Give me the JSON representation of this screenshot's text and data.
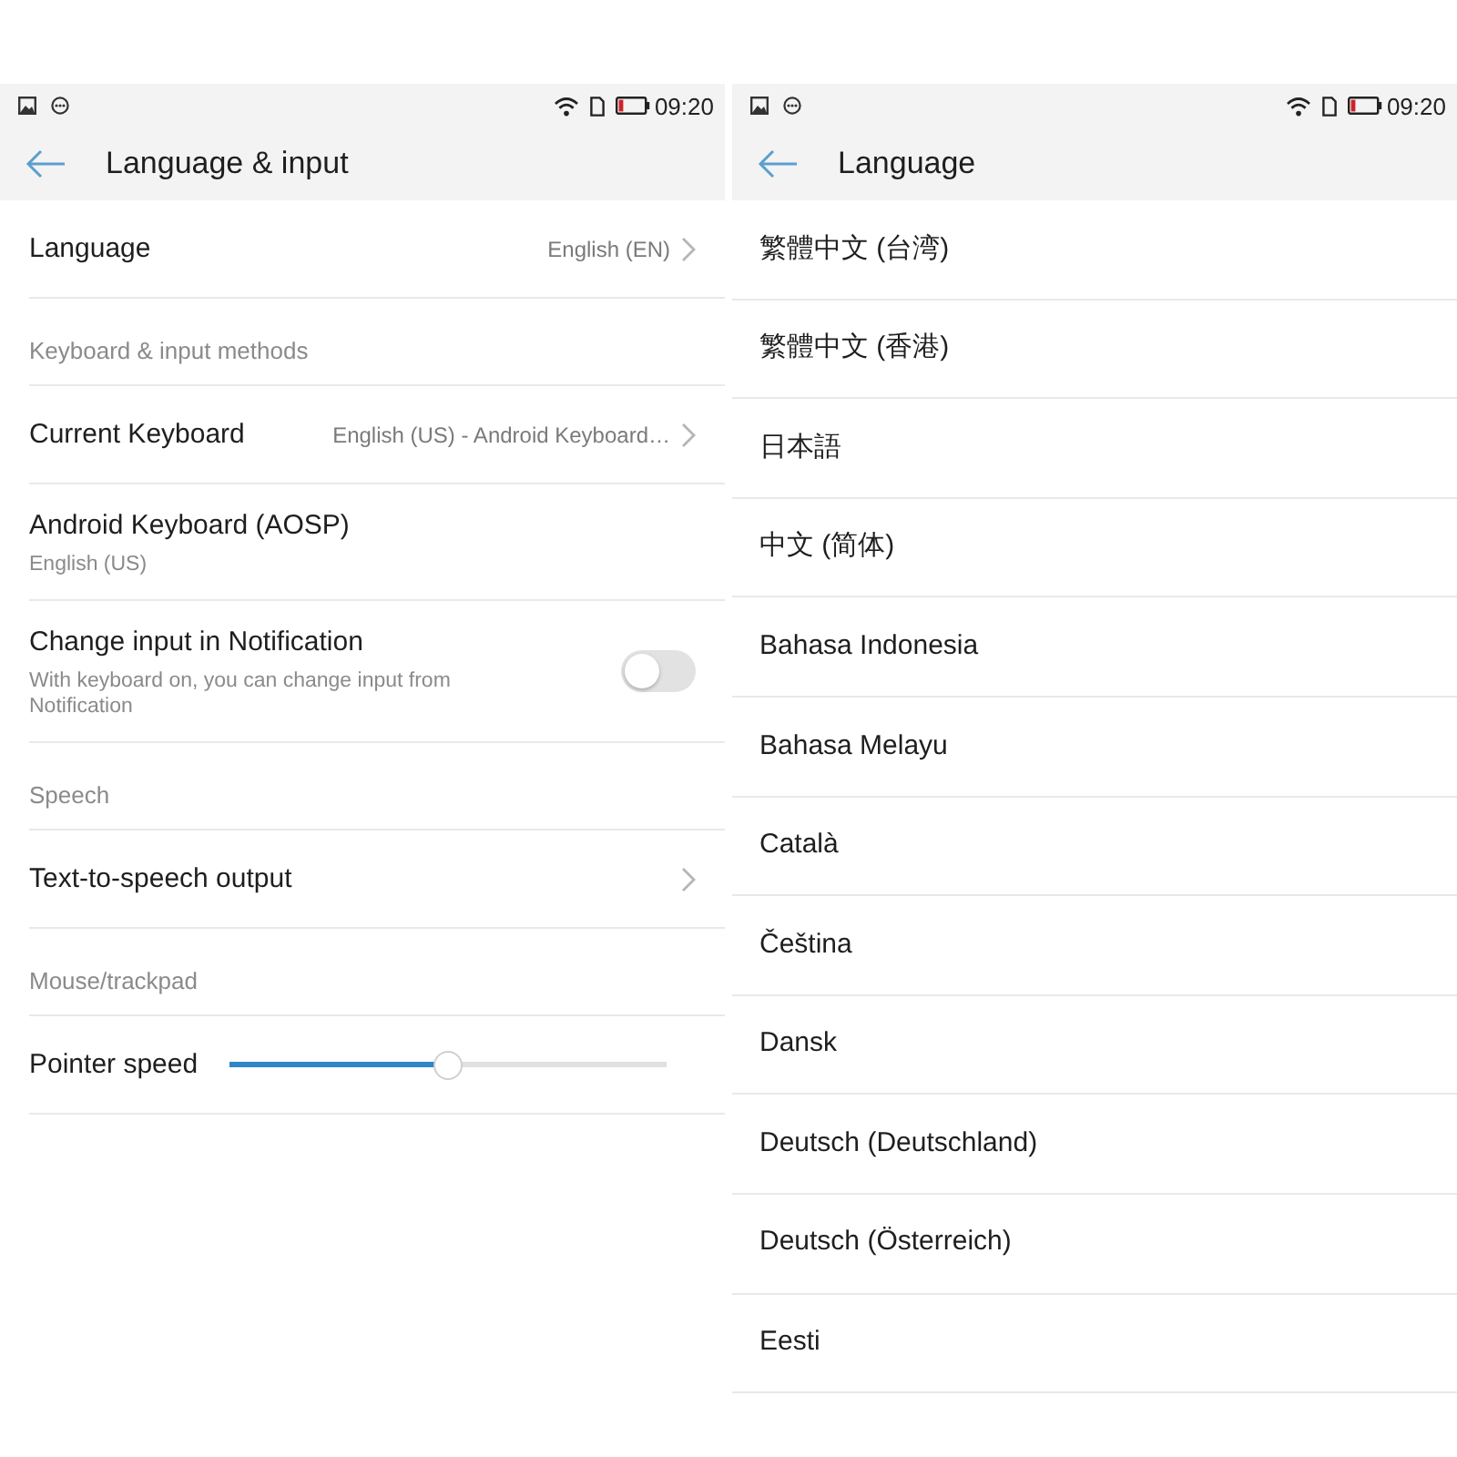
{
  "screens": [
    {
      "status_bar": {
        "time": "09:20"
      },
      "title": "Language & input",
      "items": [
        {
          "kind": "link",
          "title": "Language",
          "value": "English (EN)"
        },
        {
          "kind": "header",
          "title": "Keyboard & input methods"
        },
        {
          "kind": "link",
          "title": "Current Keyboard",
          "value": "English (US) - Android Keyboard…"
        },
        {
          "kind": "detail",
          "title": "Android Keyboard (AOSP)",
          "subtitle": "English (US)"
        },
        {
          "kind": "switch",
          "title": "Change input in Notification",
          "subtitle": "With keyboard on, you can change input from Notification",
          "on": false
        },
        {
          "kind": "header",
          "title": "Speech"
        },
        {
          "kind": "link",
          "title": "Text-to-speech output"
        },
        {
          "kind": "header",
          "title": "Mouse/trackpad"
        },
        {
          "kind": "slider",
          "title": "Pointer speed",
          "level": 0.5
        }
      ]
    },
    {
      "status_bar": {
        "time": "09:20"
      },
      "title": "Language",
      "languages": [
        "繁體中文 (台湾)",
        "繁體中文 (香港)",
        "日本語",
        "中文 (简体)",
        "Bahasa Indonesia",
        "Bahasa Melayu",
        "Català",
        "Čeština",
        "Dansk",
        "Deutsch (Deutschland)",
        "Deutsch (Österreich)",
        "Eesti"
      ]
    }
  ]
}
